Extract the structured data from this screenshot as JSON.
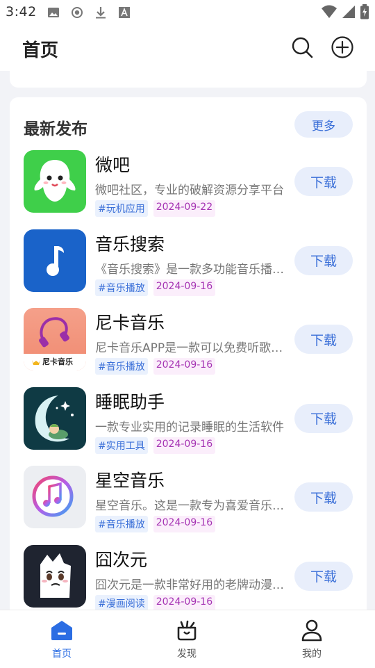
{
  "status_bar": {
    "time": "3:42",
    "left_icons": [
      "image-icon",
      "record-icon",
      "download-icon",
      "font-icon"
    ],
    "right_icons": [
      "wifi-icon",
      "signal-icon",
      "battery-icon"
    ]
  },
  "app_bar": {
    "title": "首页",
    "actions": [
      "search-icon",
      "add-circle-icon"
    ]
  },
  "latest": {
    "title": "最新发布",
    "more_label": "更多",
    "items": [
      {
        "name": "微吧",
        "desc": "微吧社区，专业的破解资源分享平台",
        "tag": "#玩机应用",
        "date": "2024-09-22",
        "button": "下载",
        "icon": "weiba-ghost-icon"
      },
      {
        "name": "音乐搜索",
        "desc": "《音乐搜索》是一款多功能音乐播放软件",
        "tag": "#音乐播放",
        "date": "2024-09-16",
        "button": "下载",
        "icon": "music-note-icon"
      },
      {
        "name": "尼卡音乐",
        "desc": "尼卡音乐APP是一款可以免费听歌的软件",
        "tag": "#音乐播放",
        "date": "2024-09-16",
        "button": "下载",
        "icon": "headphones-icon",
        "icon_caption": "尼卡音乐"
      },
      {
        "name": "睡眠助手",
        "desc": "一款专业实用的记录睡眠的生活软件",
        "tag": "#实用工具",
        "date": "2024-09-16",
        "button": "下载",
        "icon": "moon-sleep-icon"
      },
      {
        "name": "星空音乐",
        "desc": "星空音乐。这是一款专为喜爱音乐的用户打造",
        "tag": "#音乐播放",
        "date": "2024-09-16",
        "button": "下载",
        "icon": "itunes-note-icon"
      },
      {
        "name": "囧次元",
        "desc": "囧次元是一款非常好用的老牌动漫软件",
        "tag": "#漫画阅读",
        "date": "2024-09-16",
        "button": "下载",
        "icon": "cartoon-face-icon"
      }
    ]
  },
  "bottom_nav": {
    "items": [
      {
        "label": "首页",
        "icon": "home-icon",
        "active": true
      },
      {
        "label": "发现",
        "icon": "discover-icon",
        "active": false
      },
      {
        "label": "我的",
        "icon": "profile-icon",
        "active": false
      }
    ]
  },
  "colors": {
    "accent": "#2b6de3",
    "button_bg": "#e8eefb",
    "tag_category": "#3a6fd8",
    "tag_date": "#a533b3"
  }
}
